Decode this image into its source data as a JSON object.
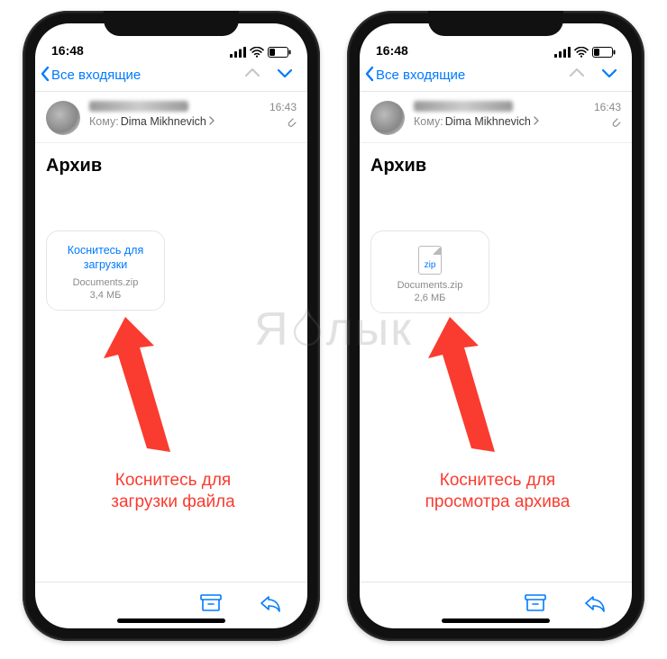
{
  "watermark": "Я лык",
  "phones": [
    {
      "status_time": "16:48",
      "back_label": "Все входящие",
      "to_label": "Кому:",
      "recipient": "Dima Mikhnevich",
      "msg_time": "16:43",
      "subject": "Архив",
      "attachment": {
        "tap_line1": "Коснитесь для",
        "tap_line2": "загрузки",
        "filename": "Documents.zip",
        "size": "3,4 МБ",
        "show_icon": false
      },
      "caption_line1": "Коснитесь для",
      "caption_line2": "загрузки файла"
    },
    {
      "status_time": "16:48",
      "back_label": "Все входящие",
      "to_label": "Кому:",
      "recipient": "Dima Mikhnevich",
      "msg_time": "16:43",
      "subject": "Архив",
      "attachment": {
        "ext": "zip",
        "filename": "Documents.zip",
        "size": "2,6 МБ",
        "show_icon": true
      },
      "caption_line1": "Коснитесь для",
      "caption_line2": "просмотра архива"
    }
  ]
}
